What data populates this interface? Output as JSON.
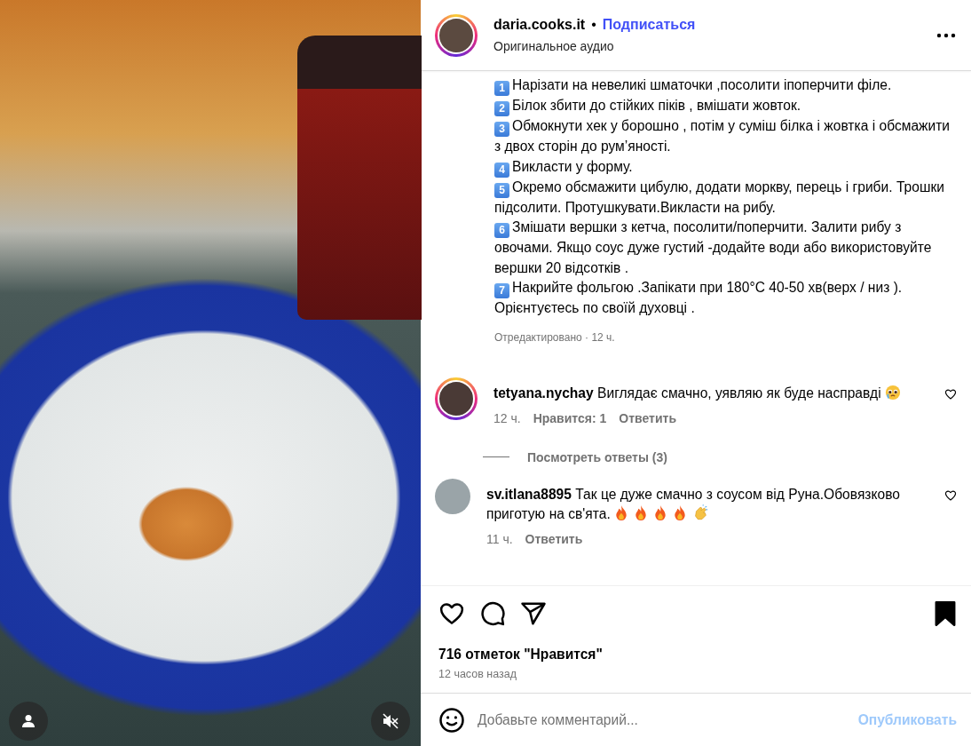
{
  "video": {
    "muted": true
  },
  "header": {
    "username": "daria.cooks.it",
    "separator": "•",
    "follow": "Подписаться",
    "audio": "Оригинальное аудио",
    "story_ring": true
  },
  "caption": {
    "steps": [
      {
        "number": "1",
        "text": "Нарізати на невеликі шматочки ,посолити іпоперчити філе."
      },
      {
        "number": "2",
        "text": "Білок збити до стійких піків , вмішати жовток."
      },
      {
        "number": "3",
        "text": "Обмокнути хек у борошно , потім у суміш білка і жовтка і обсмажити з двох сторін до рум’яності."
      },
      {
        "number": "4",
        "text": "Викласти у форму."
      },
      {
        "number": "5",
        "text": "Окремо обсмажити цибулю, додати моркву, перець і гриби. Трошки підсолити. Протушкувати.Викласти на рибу."
      },
      {
        "number": "6",
        "text": "Змішати вершки з кетча, посолити/поперчити. Залити рибу з овочами. Якщо соус дуже густий -додайте води або використовуйте вершки 20 відсотків ."
      },
      {
        "number": "7",
        "text": "Накрийте фольгою .Запікати при 180°C 40-50 хв(верх / низ ). Орієнтуєтесь по своїй духовці ."
      }
    ],
    "edited": "Отредактировано · 12 ч."
  },
  "comments": [
    {
      "username": "tetyana.nychay",
      "text": "Виглядає смачно, уявляю як буде насправді",
      "emojis": [
        {
          "kind": "pleading"
        }
      ],
      "story_ring": true,
      "liked": false,
      "time": "12 ч.",
      "likes": "Нравится: 1",
      "reply": "Ответить",
      "replies": "Посмотреть ответы (3)"
    },
    {
      "username": "sv.itlana8895",
      "text": "Так це дуже смачно з соусом від Руна.Обовязково приготую на св'ята.",
      "emojis": [
        {
          "kind": "fire"
        },
        {
          "kind": "fire"
        },
        {
          "kind": "fire"
        },
        {
          "kind": "fire"
        },
        {
          "kind": "clap"
        }
      ],
      "story_ring": false,
      "liked": false,
      "time": "11 ч.",
      "reply": "Ответить"
    }
  ],
  "actions": {
    "liked": false,
    "saved": true,
    "likes": "716 отметок \"Нравится\"",
    "time": "12 часов назад"
  },
  "comment_box": {
    "placeholder": "Добавьте комментарий...",
    "submit": "Опубликовать",
    "submit_disabled": true
  }
}
